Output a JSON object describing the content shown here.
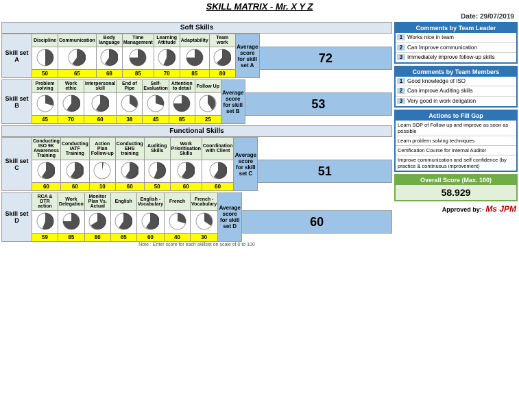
{
  "title": "SKILL MATRIX - Mr. X Y Z",
  "date": "Date: 29/07/2019",
  "soft_skills_label": "Soft Skills",
  "functional_skills_label": "Functional Skills",
  "skill_set_a": "Skill set A",
  "skill_set_b": "Skill set B",
  "skill_set_c": "Skill set C",
  "skill_set_d": "Skill set D",
  "skillset_a_cols": [
    "Discipline",
    "Communication",
    "Body language",
    "Time Management",
    "Learning Attitude",
    "Adaptability",
    "Team work",
    "Average score for skill set A"
  ],
  "skillset_a_scores": [
    "50",
    "65",
    "68",
    "85",
    "70",
    "85",
    "80",
    "72"
  ],
  "skillset_a_pies": [
    50,
    65,
    68,
    85,
    70,
    85,
    80
  ],
  "skillset_b_cols": [
    "Problem solving",
    "Work ethic",
    "Interpersonal skill",
    "End of Pipe",
    "Self-Evaluation",
    "Attention to detail",
    "Follow Up",
    "Average score for skill set B"
  ],
  "skillset_b_scores": [
    "45",
    "70",
    "60",
    "38",
    "45",
    "85",
    "25",
    "53"
  ],
  "skillset_b_pies": [
    45,
    70,
    60,
    38,
    45,
    85,
    25
  ],
  "skillset_c_cols": [
    "Conducting ISO 9K Awareness Training",
    "Conducting IATF Training",
    "Action Plan Follow-up",
    "Conducting EHS training",
    "Auditing Skills",
    "Work Prioritisation Skills",
    "Coordination with Client",
    "Average score for skill set C"
  ],
  "skillset_c_scores": [
    "60",
    "60",
    "10",
    "60",
    "50",
    "60",
    "60",
    "51"
  ],
  "skillset_c_pies": [
    60,
    60,
    10,
    60,
    50,
    60,
    60
  ],
  "skillset_d_cols": [
    "RCA & DTR action",
    "Work Delegation",
    "Monitor Plan Vs. Actual",
    "English",
    "English - Vocabulary",
    "French",
    "French - Vocabulary",
    "Average score for skill set D"
  ],
  "skillset_d_scores": [
    "59",
    "85",
    "80",
    "65",
    "60",
    "40",
    "30",
    "60"
  ],
  "skillset_d_pies": [
    59,
    85,
    80,
    65,
    60,
    40,
    30
  ],
  "comments_leader_header": "Comments by Team Leader",
  "comments_leader": [
    "Works nice in team",
    "Can Improve communication",
    "Immediately improve follow-up skills"
  ],
  "comments_members_header": "Comments by Team Members",
  "comments_members": [
    "Good knowledge of ISO",
    "Can improve Auditing skills",
    "Very good in work deligation"
  ],
  "actions_header": "Actions to Fill Gap",
  "actions": [
    "Learn SOP of Follow up and improve as soon as possible",
    "Learn problem solving techniques",
    "Certification Course for Internal Auditor",
    "Improve communication and self confidence (by practice & continuous improvement)"
  ],
  "overall_label": "Overall Score (Max. 100)",
  "overall_value": "58.929",
  "approved_by": "Approved by:-",
  "approved_name": "Ms JPM",
  "note": "Note : Enter score for each skillset on scale of 0 to 100"
}
